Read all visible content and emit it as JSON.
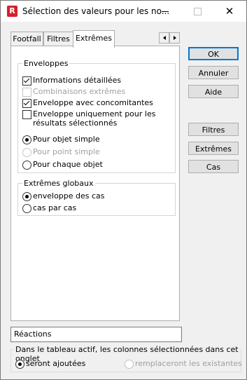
{
  "window": {
    "title": "Sélection des valeurs pour les no...",
    "app_icon_letter": "R"
  },
  "tabs": [
    {
      "label": "Footfall",
      "active": false
    },
    {
      "label": "Filtres",
      "active": false
    },
    {
      "label": "Extrêmes",
      "active": true
    }
  ],
  "enveloppes": {
    "legend": "Enveloppes",
    "checkboxes": [
      {
        "label": "Informations détaillées",
        "checked": true,
        "disabled": false
      },
      {
        "label": "Combinaisons extrêmes",
        "checked": false,
        "disabled": true
      },
      {
        "label": "Enveloppe avec concomitantes",
        "checked": true,
        "disabled": false
      },
      {
        "label_line1": "Enveloppe uniquement pour les",
        "label_line2": "résultats sélectionnés",
        "checked": false,
        "disabled": false
      }
    ],
    "radios": [
      {
        "label": "Pour objet simple",
        "selected": true,
        "disabled": false
      },
      {
        "label": "Pour point simple",
        "selected": false,
        "disabled": true
      },
      {
        "label": "Pour chaque objet",
        "selected": false,
        "disabled": false
      }
    ]
  },
  "extremes_globaux": {
    "legend": "Extrêmes globaux",
    "radios": [
      {
        "label": "enveloppe des cas",
        "selected": true
      },
      {
        "label": "cas par cas",
        "selected": false
      }
    ]
  },
  "buttons": {
    "ok": "OK",
    "annuler": "Annuler",
    "aide": "Aide",
    "filtres": "Filtres",
    "extremes": "Extrêmes",
    "cas": "Cas"
  },
  "table_name": "Réactions",
  "columns_group": {
    "legend": "Dans le tableau actif, les colonnes sélectionnées dans cet onglet",
    "option_added": "seront ajoutées",
    "option_replace": "remplaceront les existantes"
  }
}
